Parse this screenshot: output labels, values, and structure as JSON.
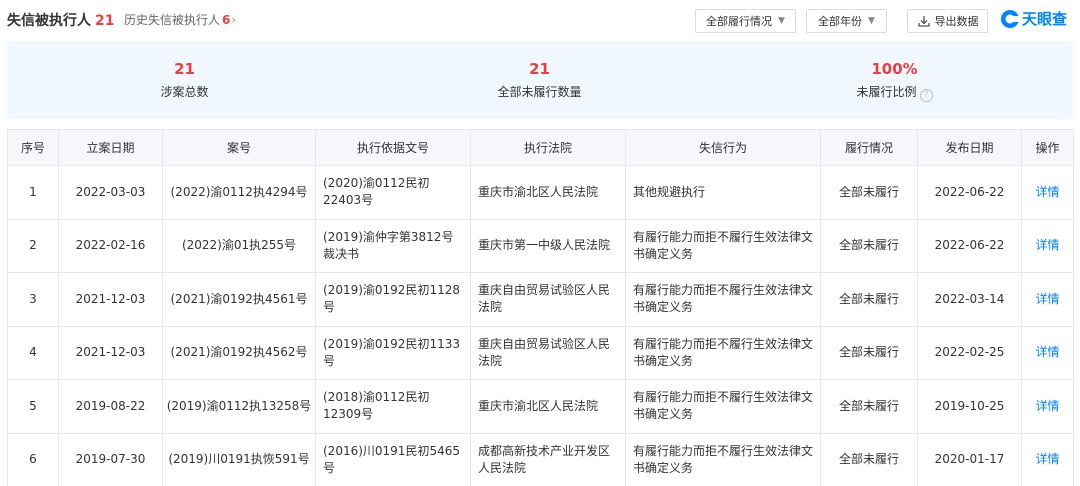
{
  "header": {
    "title": "失信被执行人",
    "title_count": "21",
    "history_label": "历史失信被执行人",
    "history_count": "6",
    "filter_status": "全部履行情况",
    "filter_year": "全部年份",
    "export_label": "导出数据",
    "logo_text": "天眼查"
  },
  "summary": [
    {
      "value": "21",
      "label": "涉案总数"
    },
    {
      "value": "21",
      "label": "全部未履行数量"
    },
    {
      "value": "100%",
      "label": "未履行比例"
    }
  ],
  "table": {
    "columns": [
      "序号",
      "立案日期",
      "案号",
      "执行依据文号",
      "执行法院",
      "失信行为",
      "履行情况",
      "发布日期",
      "操作"
    ],
    "rows": [
      [
        "1",
        "2022-03-03",
        "(2022)渝0112执4294号",
        "(2020)渝0112民初22403号",
        "重庆市渝北区人民法院",
        "其他规避执行",
        "全部未履行",
        "2022-06-22",
        "详情"
      ],
      [
        "2",
        "2022-02-16",
        "(2022)渝01执255号",
        "(2019)渝仲字第3812号裁决书",
        "重庆市第一中级人民法院",
        "有履行能力而拒不履行生效法律文书确定义务",
        "全部未履行",
        "2022-06-22",
        "详情"
      ],
      [
        "3",
        "2021-12-03",
        "(2021)渝0192执4561号",
        "(2019)渝0192民初1128号",
        "重庆自由贸易试验区人民法院",
        "有履行能力而拒不履行生效法律文书确定义务",
        "全部未履行",
        "2022-03-14",
        "详情"
      ],
      [
        "4",
        "2021-12-03",
        "(2021)渝0192执4562号",
        "(2019)渝0192民初1133号",
        "重庆自由贸易试验区人民法院",
        "有履行能力而拒不履行生效法律文书确定义务",
        "全部未履行",
        "2022-02-25",
        "详情"
      ],
      [
        "5",
        "2019-08-22",
        "(2019)渝0112执13258号",
        "(2018)渝0112民初12309号",
        "重庆市渝北区人民法院",
        "有履行能力而拒不履行生效法律文书确定义务",
        "全部未履行",
        "2019-10-25",
        "详情"
      ],
      [
        "6",
        "2019-07-30",
        "(2019)川0191执恢591号",
        "(2016)川0191民初5465号",
        "成都高新技术产业开发区人民法院",
        "有履行能力而拒不履行生效法律文书确定义务",
        "全部未履行",
        "2020-01-17",
        "详情"
      ]
    ]
  },
  "colors": {
    "accent": "#0084ff",
    "highlight": "#e8413f",
    "summary_bg": "#f1f7ff",
    "header_bg": "#f5f7fa"
  },
  "icons": [
    "chevron-right-icon",
    "caret-down-icon",
    "download-icon",
    "tianyancha-logo-icon",
    "help-icon"
  ]
}
